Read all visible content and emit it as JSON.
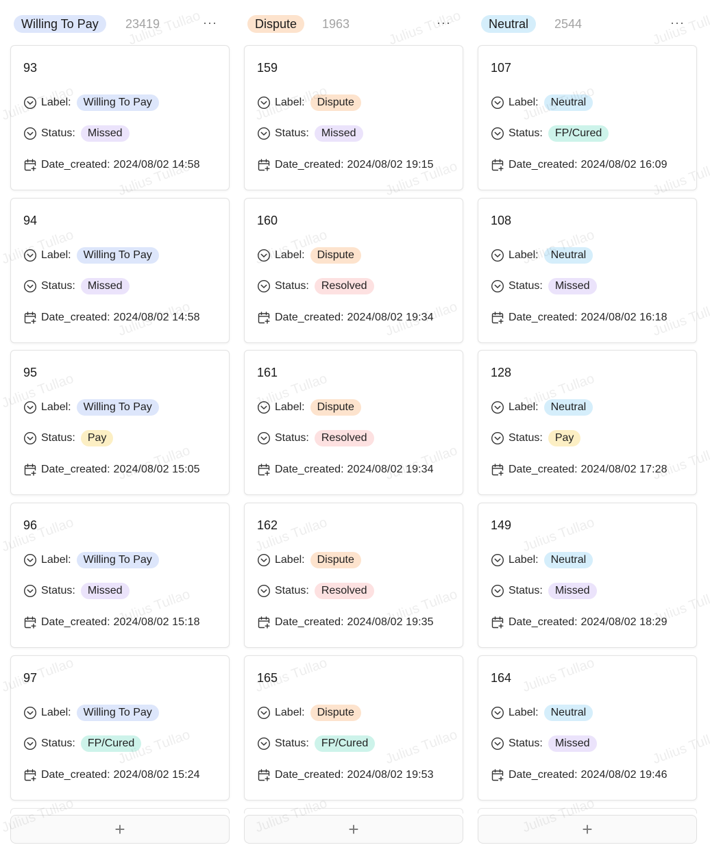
{
  "columns": [
    {
      "title": "Willing To Pay",
      "count": "23419",
      "more": "···",
      "tag_color": "#dde6fb",
      "cards": [
        {
          "id": "93",
          "label": "Willing To Pay",
          "status": "Missed",
          "date": "2024/08/02  14:58"
        },
        {
          "id": "94",
          "label": "Willing To Pay",
          "status": "Missed",
          "date": "2024/08/02  14:58"
        },
        {
          "id": "95",
          "label": "Willing To Pay",
          "status": "Pay",
          "date": "2024/08/02  15:05"
        },
        {
          "id": "96",
          "label": "Willing To Pay",
          "status": "Missed",
          "date": "2024/08/02  15:18"
        },
        {
          "id": "97",
          "label": "Willing To Pay",
          "status": "FP/Cured",
          "date": "2024/08/02  15:24"
        }
      ],
      "add": "+"
    },
    {
      "title": "Dispute",
      "count": "1963",
      "more": "···",
      "tag_color": "#fde3cd",
      "cards": [
        {
          "id": "159",
          "label": "Dispute",
          "status": "Missed",
          "date": "2024/08/02  19:15"
        },
        {
          "id": "160",
          "label": "Dispute",
          "status": "Resolved",
          "date": "2024/08/02  19:34"
        },
        {
          "id": "161",
          "label": "Dispute",
          "status": "Resolved",
          "date": "2024/08/02  19:34"
        },
        {
          "id": "162",
          "label": "Dispute",
          "status": "Resolved",
          "date": "2024/08/02  19:35"
        },
        {
          "id": "165",
          "label": "Dispute",
          "status": "FP/Cured",
          "date": "2024/08/02  19:53"
        }
      ],
      "add": "+"
    },
    {
      "title": "Neutral",
      "count": "2544",
      "more": "···",
      "tag_color": "#d5eefb",
      "cards": [
        {
          "id": "107",
          "label": "Neutral",
          "status": "FP/Cured",
          "date": "2024/08/02  16:09"
        },
        {
          "id": "108",
          "label": "Neutral",
          "status": "Missed",
          "date": "2024/08/02  16:18"
        },
        {
          "id": "128",
          "label": "Neutral",
          "status": "Pay",
          "date": "2024/08/02  17:28"
        },
        {
          "id": "149",
          "label": "Neutral",
          "status": "Missed",
          "date": "2024/08/02  18:29"
        },
        {
          "id": "164",
          "label": "Neutral",
          "status": "Missed",
          "date": "2024/08/02  19:46"
        }
      ],
      "add": "+"
    }
  ],
  "field_names": {
    "label": "Label:",
    "status": "Status:",
    "date": "Date_created:"
  },
  "status_colors": {
    "Missed": "#ebe3fb",
    "Pay": "#fcefc4",
    "FP/Cured": "#cdf3ea",
    "Resolved": "#fde1e1"
  },
  "watermark": "Julius Tullao"
}
